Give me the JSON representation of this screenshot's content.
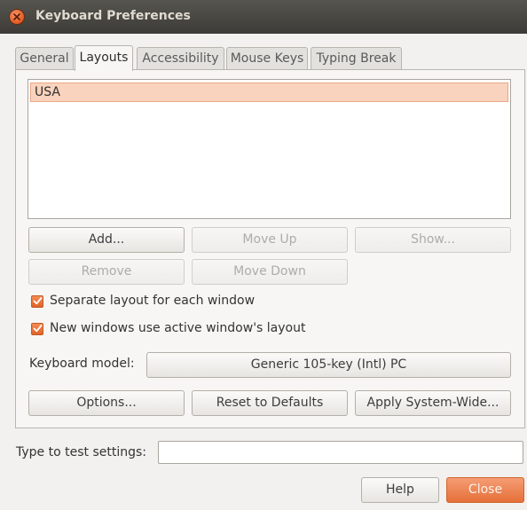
{
  "window": {
    "title": "Keyboard Preferences"
  },
  "tabs": [
    {
      "label": "General"
    },
    {
      "label": "Layouts"
    },
    {
      "label": "Accessibility"
    },
    {
      "label": "Mouse Keys"
    },
    {
      "label": "Typing Break"
    }
  ],
  "active_tab": "Layouts",
  "layouts": {
    "items": [
      {
        "label": "USA",
        "selected": true
      }
    ]
  },
  "buttons": {
    "add": "Add...",
    "move_up": "Move Up",
    "show": "Show...",
    "remove": "Remove",
    "move_down": "Move Down",
    "options": "Options...",
    "reset": "Reset to Defaults",
    "apply": "Apply System-Wide...",
    "help": "Help",
    "close": "Close"
  },
  "checkboxes": {
    "separate_layout": {
      "label": "Separate layout for each window",
      "checked": true
    },
    "new_windows": {
      "label": "New windows use active window's layout",
      "checked": true
    }
  },
  "keyboard_model": {
    "label": "Keyboard model:",
    "value": "Generic 105-key (Intl) PC"
  },
  "test": {
    "label": "Type to test settings:",
    "value": ""
  },
  "colors": {
    "accent": "#e0692e",
    "selection": "#f9d3bd",
    "titlebar": "#3c3b37"
  }
}
